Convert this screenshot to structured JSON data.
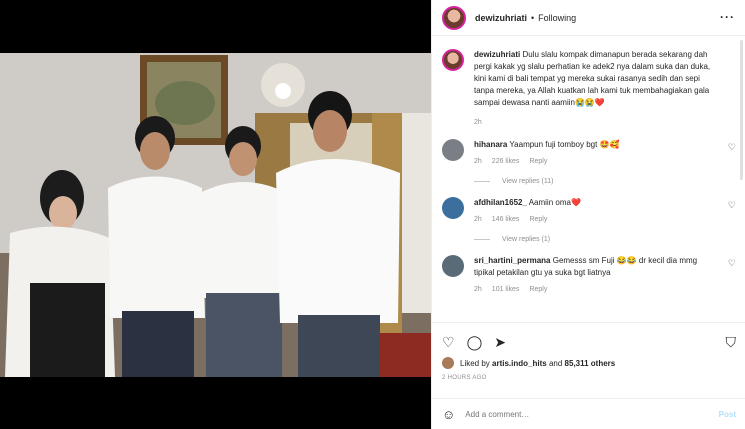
{
  "post": {
    "author": "dewizuhriati",
    "separator": "•",
    "follow_status": "Following",
    "caption": "Dulu slalu kompak dimanapun berada sekarang dah pergi kakak yg slalu perhatian ke adek2 nya dalam suka dan duka, kini kami di bali tempat yg mereka sukai rasanya sedih dan sepi tanpa mereka, ya Allah kuatkan lah kami tuk membahagiakan gala sampai dewasa nanti aamiin😭😭❤️",
    "caption_time": "2h"
  },
  "comments": [
    {
      "user": "hihanara",
      "text": "Yaampun fuji tomboy bgt 🤩🥰",
      "time": "2h",
      "likes": "226 likes",
      "reply": "Reply",
      "view_replies": "View replies (11)",
      "avatar_color": "#7a7f86"
    },
    {
      "user": "afdhilan1652_",
      "text": "Aamiin oma❤️",
      "time": "2h",
      "likes": "146 likes",
      "reply": "Reply",
      "view_replies": "View replies (1)",
      "avatar_color": "#3c6f9e"
    },
    {
      "user": "sri_hartini_permana",
      "text": "Gemesss sm Fuji 😂😂 dr kecil dia mmg tipikal petakilan gtu ya suka bgt liatnya",
      "time": "2h",
      "likes": "101 likes",
      "reply": "Reply",
      "avatar_color": "#5a6b78"
    }
  ],
  "actions": {
    "liked_by_prefix": "Liked by",
    "liked_by_user": "artis.indo_hits",
    "liked_by_and": "and",
    "liked_by_others": "85,311 others",
    "time_ago": "2 HOURS AGO"
  },
  "add_comment": {
    "placeholder": "Add a comment…",
    "post_label": "Post"
  },
  "icons": [
    "heart-icon",
    "comment-icon",
    "share-icon",
    "bookmark-icon",
    "emoji-icon",
    "more-icon"
  ]
}
